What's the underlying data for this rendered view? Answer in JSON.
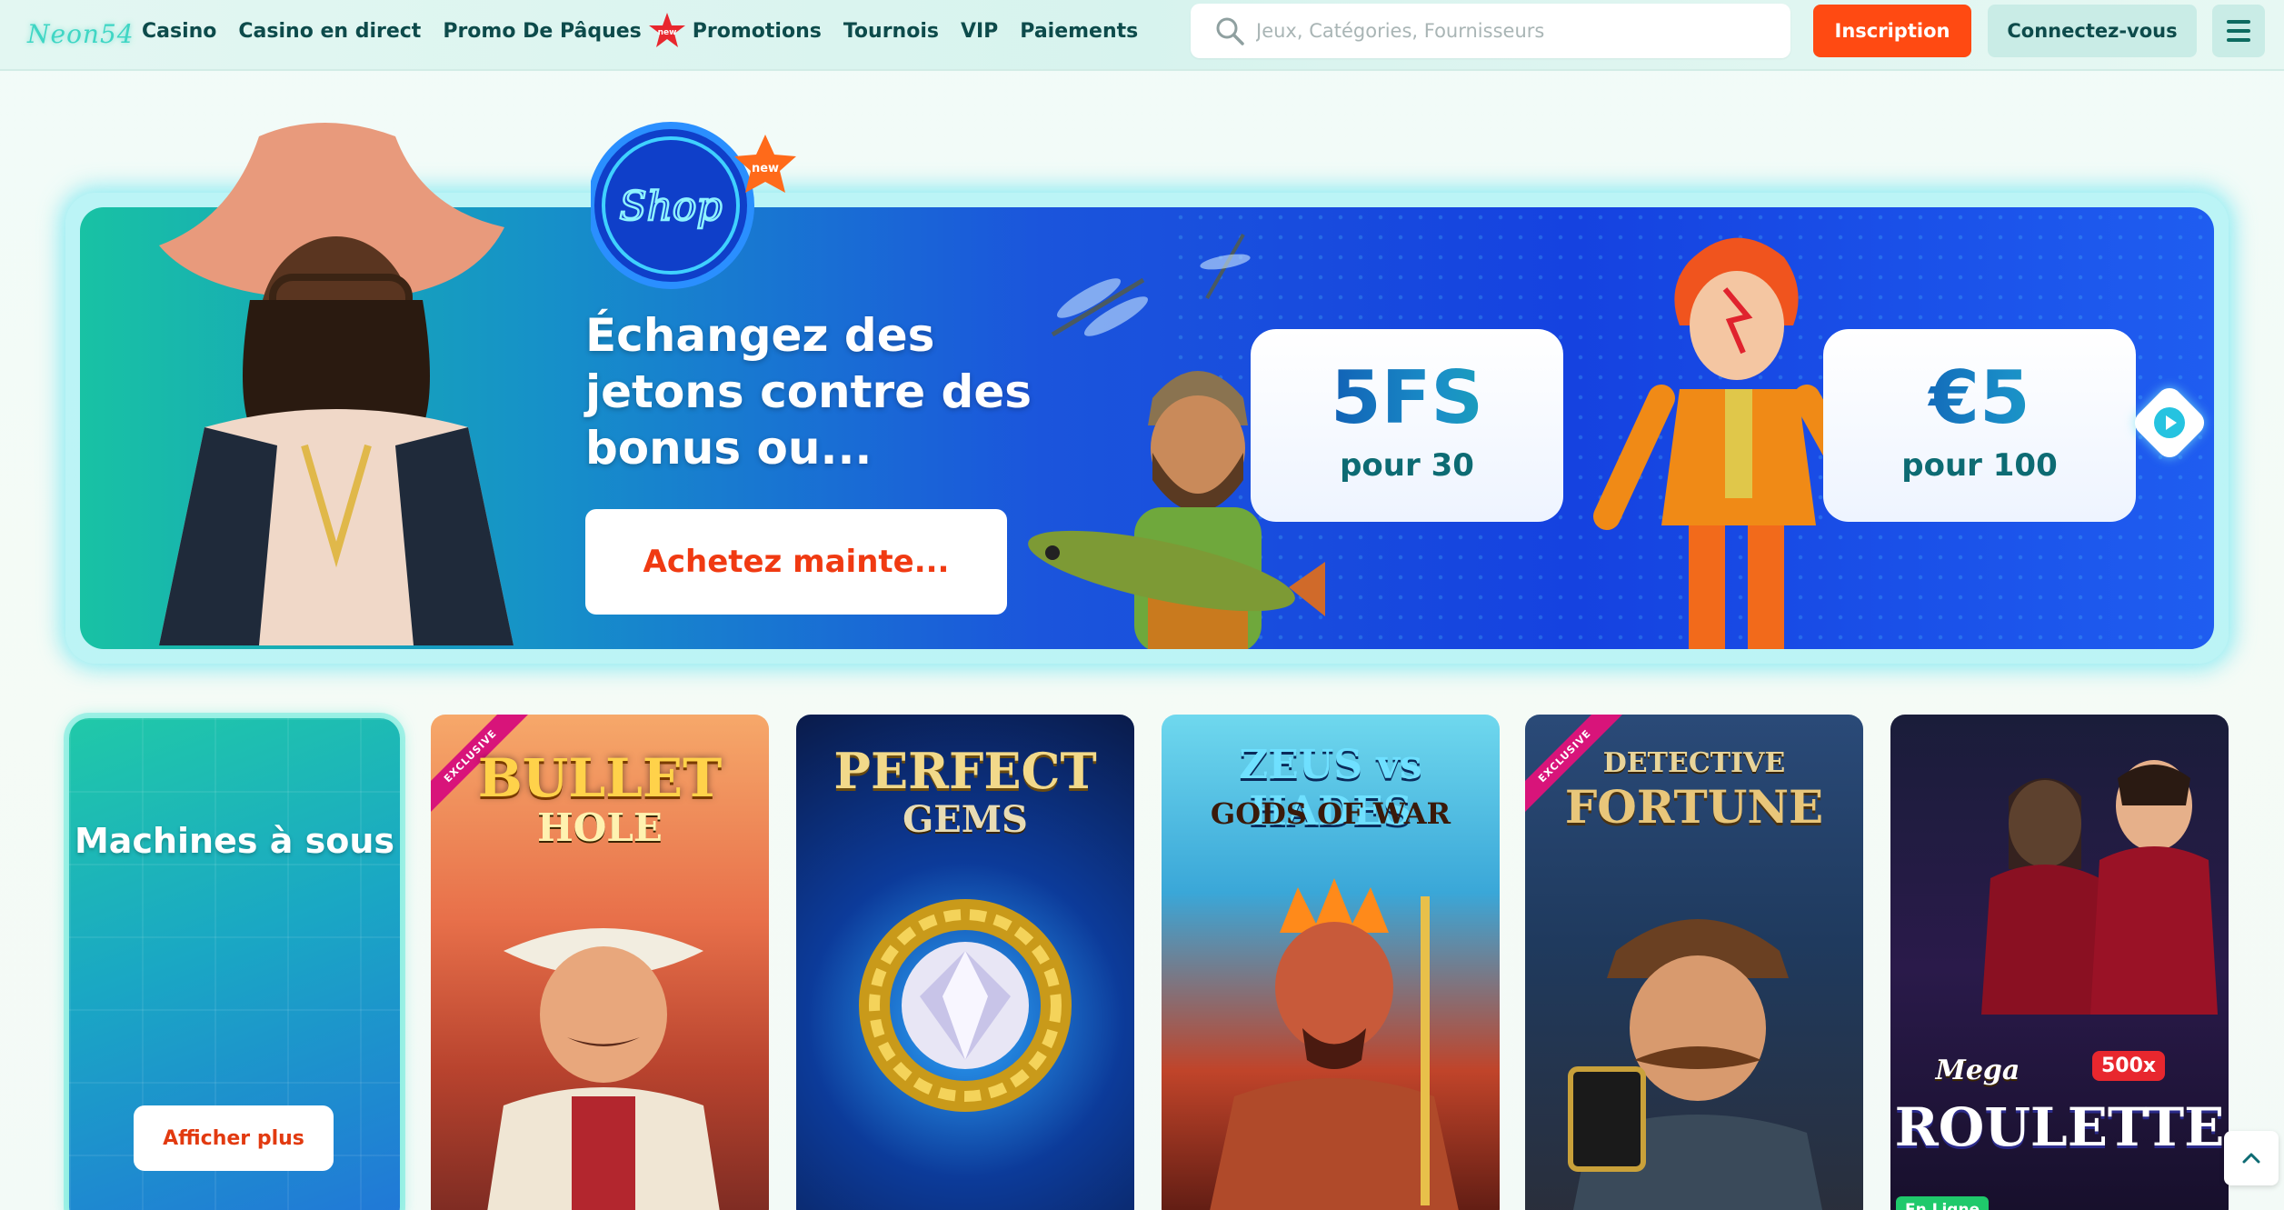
{
  "header": {
    "logo_text": "Neon54",
    "nav": [
      {
        "label": "Casino"
      },
      {
        "label": "Casino en direct"
      },
      {
        "label": "Promo De Pâques",
        "badge": "new"
      },
      {
        "label": "Promotions"
      },
      {
        "label": "Tournois"
      },
      {
        "label": "VIP"
      },
      {
        "label": "Paiements"
      }
    ],
    "search_placeholder": "Jeux, Catégories, Fournisseurs",
    "signup_label": "Inscription",
    "login_label": "Connectez-vous"
  },
  "hero": {
    "shop_badge_text": "Shop",
    "shop_badge_new": "new",
    "title": "Échangez des jetons contre des bonus ou...",
    "cta_label": "Achetez mainte...",
    "offers": [
      {
        "value": "5FS",
        "sub": "pour 30"
      },
      {
        "value": "€5",
        "sub": "pour 100"
      }
    ]
  },
  "games": {
    "category_title": "Machines à sous",
    "more_label": "Afficher plus",
    "tiles": [
      {
        "title": "BULLET",
        "subtitle": "HOLE",
        "ribbon": "EXCLUSIVE"
      },
      {
        "title": "PERFECT",
        "subtitle": "GEMS"
      },
      {
        "title": "ZEUS vs HADES",
        "subtitle": "GODS OF WAR"
      },
      {
        "title": "DETECTIVE",
        "subtitle": "FORTUNE",
        "ribbon": "EXCLUSIVE"
      },
      {
        "title": "ROULETTE",
        "subtitle": "Mega",
        "multiplier": "500x",
        "live": "En Ligne"
      }
    ]
  },
  "colors": {
    "accent_orange": "#ff4a12",
    "teal": "#0d4b4b",
    "hero_blue": "#1542e0"
  }
}
